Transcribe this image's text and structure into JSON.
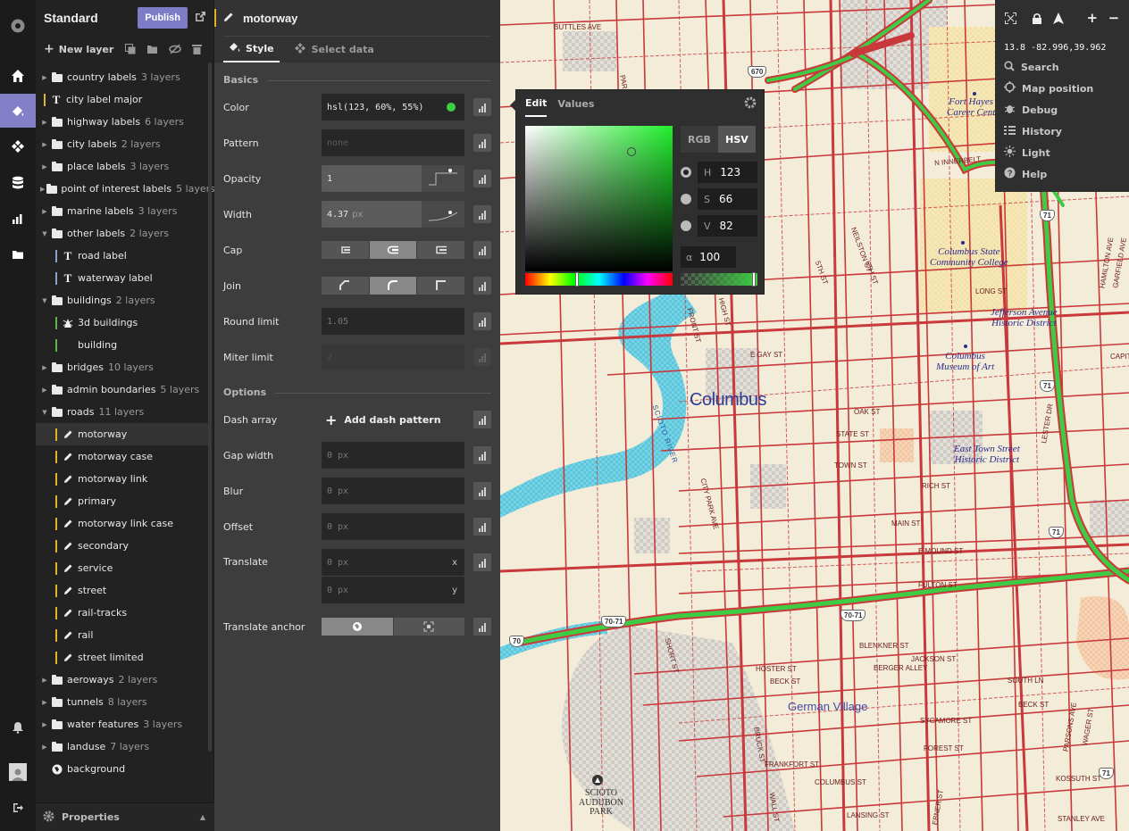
{
  "sidebar_rail": {
    "icons": [
      "logo-icon",
      "home-icon",
      "style-icon",
      "components-icon",
      "data-icon",
      "stats-icon",
      "docs-icon",
      "notifications-icon",
      "account-icon",
      "exit-icon"
    ]
  },
  "layers_panel": {
    "style_name": "Standard",
    "publish_label": "Publish",
    "new_layer_label": "New layer",
    "properties_label": "Properties",
    "items": [
      {
        "type": "group",
        "name": "country labels",
        "count": "3 layers",
        "open": false
      },
      {
        "type": "text",
        "name": "city label major",
        "bar": "#e1b22c"
      },
      {
        "type": "group",
        "name": "highway labels",
        "count": "6 layers",
        "open": false
      },
      {
        "type": "group",
        "name": "city labels",
        "count": "2 layers",
        "open": false
      },
      {
        "type": "group",
        "name": "place labels",
        "count": "3 layers",
        "open": false
      },
      {
        "type": "group",
        "name": "point of interest labels",
        "count": "5 layers",
        "open": false
      },
      {
        "type": "group",
        "name": "marine labels",
        "count": "3 layers",
        "open": false
      },
      {
        "type": "group",
        "name": "other labels",
        "count": "2 layers",
        "open": true
      },
      {
        "type": "text",
        "name": "road label",
        "bar": "#8aa3c9",
        "indent": true
      },
      {
        "type": "text",
        "name": "waterway label",
        "bar": "#8aa3c9",
        "indent": true
      },
      {
        "type": "group",
        "name": "buildings",
        "count": "2 layers",
        "open": true
      },
      {
        "type": "extrusion",
        "name": "3d buildings",
        "bar": "#5fb348",
        "indent": true
      },
      {
        "type": "fill",
        "name": "building",
        "bar": "#5fb348",
        "indent": true
      },
      {
        "type": "group",
        "name": "bridges",
        "count": "10 layers",
        "open": false
      },
      {
        "type": "group",
        "name": "admin boundaries",
        "count": "5 layers",
        "open": false
      },
      {
        "type": "group",
        "name": "roads",
        "count": "11 layers",
        "open": true
      },
      {
        "type": "line",
        "name": "motorway",
        "bar": "#e1b22c",
        "indent": true,
        "selected": true
      },
      {
        "type": "line",
        "name": "motorway case",
        "bar": "#e1b22c",
        "indent": true
      },
      {
        "type": "line",
        "name": "motorway link",
        "bar": "#e1b22c",
        "indent": true
      },
      {
        "type": "line",
        "name": "primary",
        "bar": "#e1b22c",
        "indent": true
      },
      {
        "type": "line",
        "name": "motorway link case",
        "bar": "#e1b22c",
        "indent": true
      },
      {
        "type": "line",
        "name": "secondary",
        "bar": "#e1b22c",
        "indent": true
      },
      {
        "type": "line",
        "name": "service",
        "bar": "#e1b22c",
        "indent": true
      },
      {
        "type": "line",
        "name": "street",
        "bar": "#e1b22c",
        "indent": true
      },
      {
        "type": "line",
        "name": "rail-tracks",
        "bar": "#e1b22c",
        "indent": true
      },
      {
        "type": "line",
        "name": "rail",
        "bar": "#e1b22c",
        "indent": true
      },
      {
        "type": "line",
        "name": "street limited",
        "bar": "#e1b22c",
        "indent": true
      },
      {
        "type": "group",
        "name": "aeroways",
        "count": "2 layers",
        "open": false
      },
      {
        "type": "group",
        "name": "tunnels",
        "count": "8 layers",
        "open": false
      },
      {
        "type": "group",
        "name": "water features",
        "count": "3 layers",
        "open": false
      },
      {
        "type": "group",
        "name": "landuse",
        "count": "7 layers",
        "open": false
      },
      {
        "type": "background",
        "name": "background"
      }
    ]
  },
  "style_panel": {
    "layer_name": "motorway",
    "tabs": {
      "style": "Style",
      "select_data": "Select data"
    },
    "sections": {
      "basics": "Basics",
      "options": "Options"
    },
    "color": {
      "label": "Color",
      "value": "hsl(123, 60%, 55%)",
      "swatch": "#3dcc44"
    },
    "pattern": {
      "label": "Pattern",
      "placeholder": "none"
    },
    "opacity": {
      "label": "Opacity",
      "value": "1"
    },
    "width": {
      "label": "Width",
      "value": "4.37",
      "unit": "px"
    },
    "cap": {
      "label": "Cap",
      "selected_index": 1
    },
    "join": {
      "label": "Join",
      "selected_index": 1
    },
    "round_limit": {
      "label": "Round limit",
      "placeholder": "1.05"
    },
    "miter_limit": {
      "label": "Miter limit",
      "placeholder": "2"
    },
    "dash_array": {
      "label": "Dash array",
      "action": "Add dash pattern"
    },
    "gap_width": {
      "label": "Gap width",
      "placeholder": "0 px"
    },
    "blur": {
      "label": "Blur",
      "placeholder": "0 px"
    },
    "offset": {
      "label": "Offset",
      "placeholder": "0 px"
    },
    "translate": {
      "label": "Translate",
      "x_placeholder": "0 px",
      "y_placeholder": "0 px",
      "x_axis": "x",
      "y_axis": "y"
    },
    "translate_anchor": {
      "label": "Translate anchor"
    }
  },
  "color_picker": {
    "tabs": {
      "edit": "Edit",
      "values": "Values"
    },
    "modes": {
      "rgb": "RGB",
      "hsv": "HSV"
    },
    "active_mode": "HSV",
    "channels": {
      "h": {
        "key": "H",
        "value": "123"
      },
      "s": {
        "key": "S",
        "value": "66"
      },
      "v": {
        "key": "V",
        "value": "82"
      },
      "alpha": {
        "key": "α",
        "value": "100"
      }
    },
    "hue": 123,
    "saturation": 0.66,
    "brightness": 0.82,
    "alpha": 1.0
  },
  "map_controls": {
    "coords": "13.8 -82.996,39.962",
    "items": [
      "Search",
      "Map position",
      "Debug",
      "History",
      "Light",
      "Help"
    ]
  },
  "map": {
    "labels": {
      "columbus": "Columbus",
      "german_village": "German Village",
      "fort_hayes": "Fort Hayes\nCareer Cent",
      "columbus_state": "Columbus State\nCommunity College",
      "jefferson": "Jefferson Avenue\nHistoric District",
      "museum": "Columbus\nMuseum of Art",
      "east_town": "East Town Street\nHistoric District",
      "scioto_audubon": "SCIOTO\nAUDUBON\nPARK",
      "scioto_river": "SCIOTO RIVER"
    },
    "streets": [
      "BUTTLES AVE",
      "N INNERBELT",
      "LONG ST",
      "E GAY ST",
      "OAK ST",
      "STATE ST",
      "TOWN ST",
      "RICH ST",
      "MAIN ST",
      "E MOUND ST",
      "FULTON ST",
      "BLENKNER ST",
      "JACKSON ST",
      "BERGER ALLEY",
      "SOUTH LN",
      "HOSTER ST",
      "BECK ST",
      "SYCAMORE ST",
      "FOREST ST",
      "FRANKFORT ST",
      "COLUMBUS ST",
      "LANSING ST",
      "KOSSUTH ST",
      "STANLEY AVE",
      "BECK ST",
      "6TH ST",
      "5TH ST",
      "NEILSTON ST",
      "HAMILTON AVE",
      "GARFIELD AVE",
      "PARSONS AVE",
      "LESTER DR",
      "FRONT ST",
      "HIGH ST",
      "SHORT ST",
      "PARK",
      "CAPITA",
      "WAGER ST",
      "EBNER ST",
      "WALL ST",
      "CITY PARK AVE",
      "BRUCK ST"
    ],
    "shields": [
      "670",
      "71",
      "71",
      "71",
      "70-71",
      "70",
      "70-71",
      "71"
    ]
  }
}
